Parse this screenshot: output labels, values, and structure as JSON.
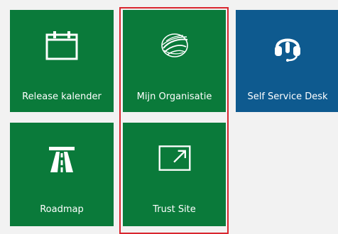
{
  "colors": {
    "tile_green": "#0a7a3a",
    "tile_blue": "#0e5a8f",
    "selection_border": "#d9262e",
    "background": "#f2f2f2"
  },
  "tiles": [
    {
      "label": "Release kalender",
      "icon": "calendar-icon",
      "color": "#0a7a3a"
    },
    {
      "label": "Mijn Organisatie",
      "icon": "globe-swirl-icon",
      "color": "#0a7a3a"
    },
    {
      "label": "Self Service Desk",
      "icon": "headset-icon",
      "color": "#0e5a8f"
    },
    {
      "label": "Roadmap",
      "icon": "road-icon",
      "color": "#0a7a3a"
    },
    {
      "label": "Trust Site",
      "icon": "external-link-icon",
      "color": "#0a7a3a"
    }
  ]
}
